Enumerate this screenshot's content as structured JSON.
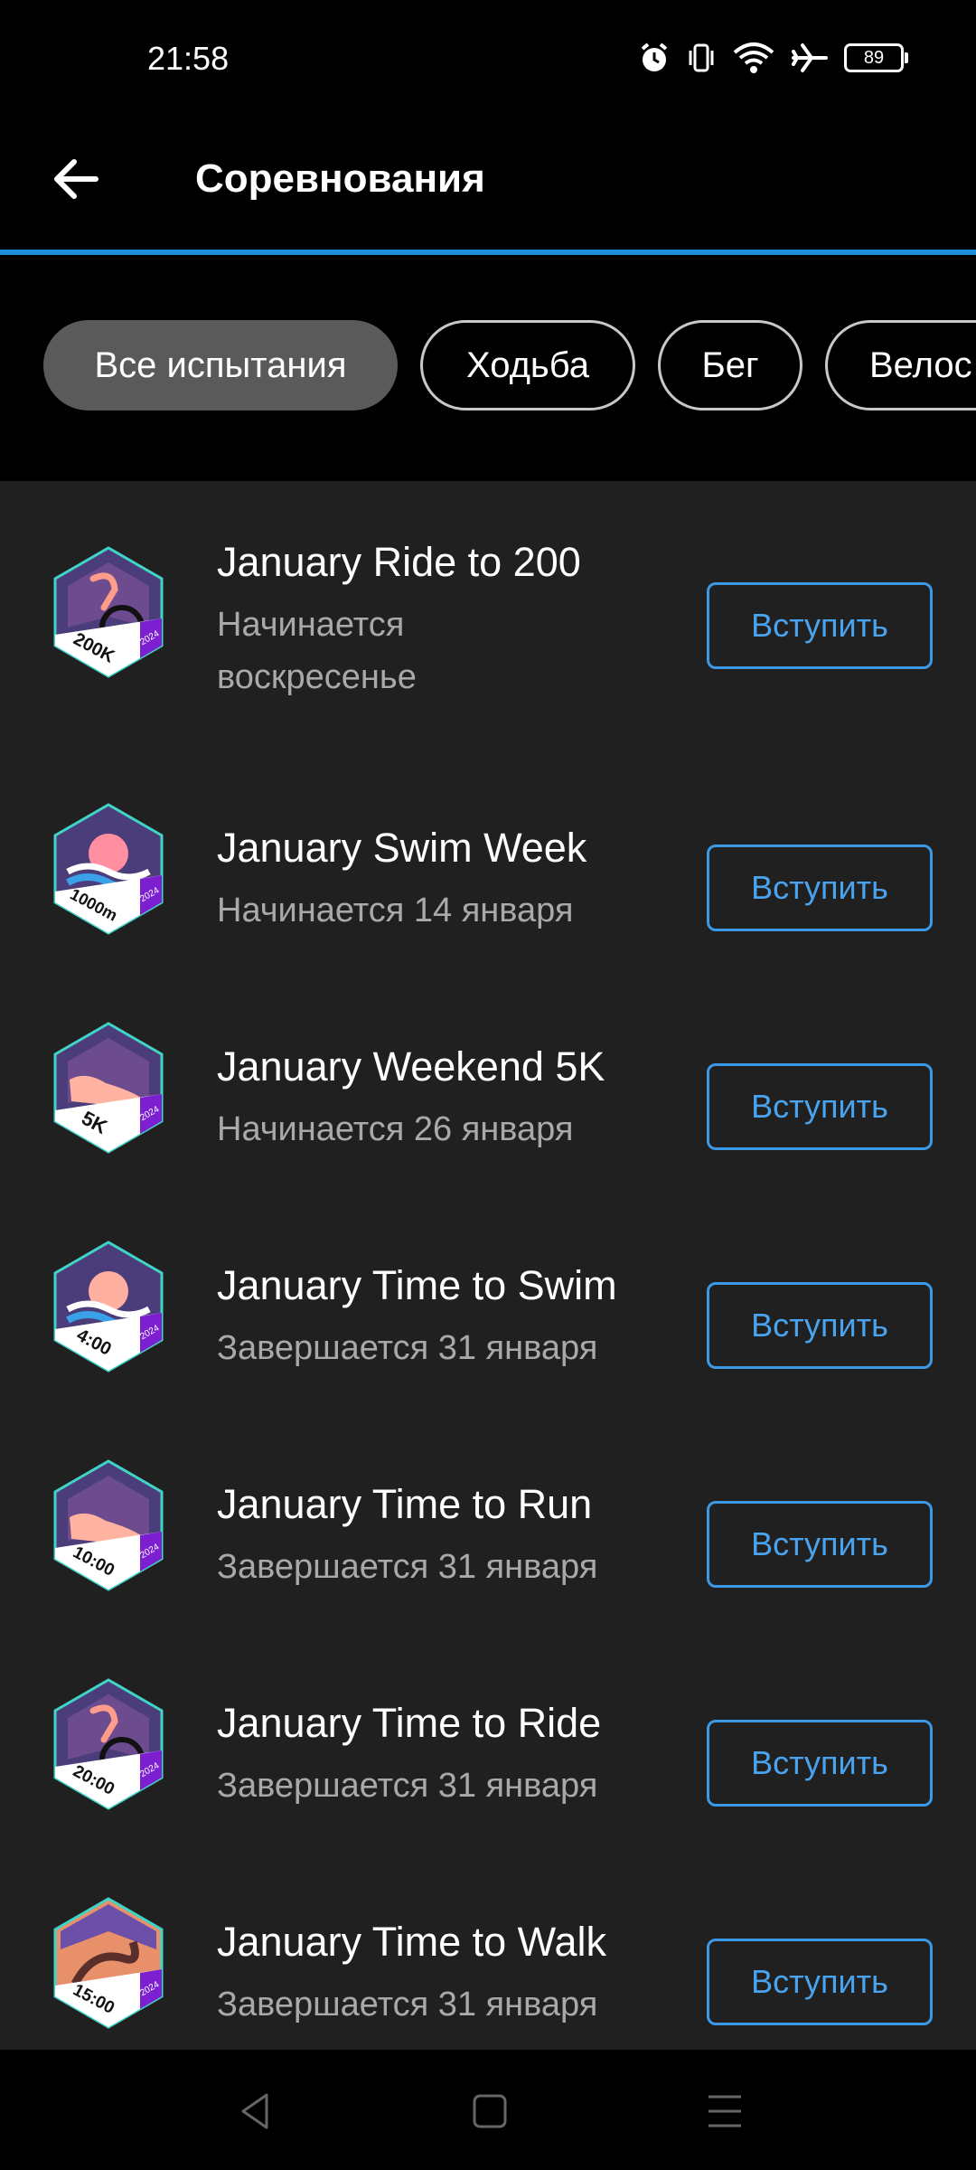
{
  "status_bar": {
    "time": "21:58",
    "battery": "89",
    "icons": [
      "alarm-icon",
      "vibrate-icon",
      "wifi-icon",
      "airplane-icon",
      "battery-icon"
    ]
  },
  "header": {
    "title": "Соревнования",
    "back_icon": "arrow-left-icon"
  },
  "filters": {
    "chips": [
      {
        "label": "Все испытания",
        "active": true
      },
      {
        "label": "Ходьба",
        "active": false
      },
      {
        "label": "Бег",
        "active": false
      },
      {
        "label": "Велос",
        "active": false
      }
    ]
  },
  "challenges": [
    {
      "name": "January Ride to 200",
      "status_line1": "Начинается",
      "status_line2": "воскресенье",
      "badge_text": "200K",
      "badge_year": "2024",
      "badge_kind": "cycling",
      "action": "Вступить"
    },
    {
      "name": "January Swim Week",
      "status_line1": "Начинается 14 января",
      "status_line2": "",
      "badge_text": "1000m",
      "badge_year": "2024",
      "badge_kind": "swimming",
      "action": "Вступить"
    },
    {
      "name": "January Weekend 5K",
      "status_line1": "Начинается 26 января",
      "status_line2": "",
      "badge_text": "5K",
      "badge_year": "2024",
      "badge_kind": "running",
      "action": "Вступить"
    },
    {
      "name": "January Time to Swim",
      "status_line1": "Завершается 31 января",
      "status_line2": "",
      "badge_text": "4:00",
      "badge_year": "2024",
      "badge_kind": "swimming",
      "action": "Вступить"
    },
    {
      "name": "January Time to Run",
      "status_line1": "Завершается 31 января",
      "status_line2": "",
      "badge_text": "10:00",
      "badge_year": "2024",
      "badge_kind": "running",
      "action": "Вступить"
    },
    {
      "name": "January Time to Ride",
      "status_line1": "Завершается 31 января",
      "status_line2": "",
      "badge_text": "20:00",
      "badge_year": "2024",
      "badge_kind": "cycling",
      "action": "Вступить"
    },
    {
      "name": "January Time to Walk",
      "status_line1": "Завершается 31 января",
      "status_line2": "",
      "badge_text": "15:00",
      "badge_year": "2024",
      "badge_kind": "walking",
      "action": "Вступить"
    }
  ],
  "nav": {
    "buttons": [
      "back-triangle-icon",
      "home-square-icon",
      "menu-lines-icon"
    ]
  },
  "colors": {
    "accent_line": "#1e8fd8",
    "button_border": "#3b9ae8",
    "list_bg": "#202020"
  }
}
